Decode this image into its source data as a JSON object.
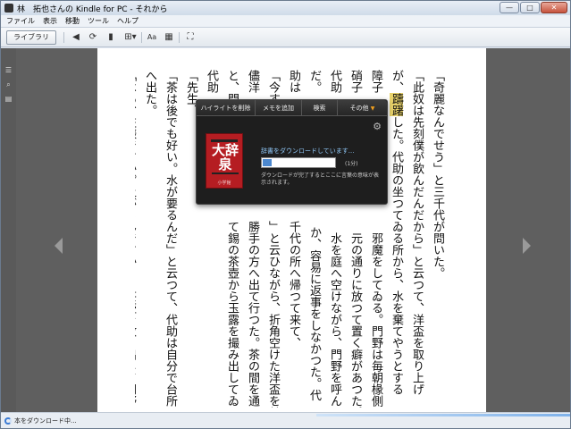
{
  "window": {
    "title": "林　拓也さんの Kindle for PC - それから",
    "minimize": "—",
    "maximize": "□",
    "close": "✕"
  },
  "menu": [
    "ファイル",
    "表示",
    "移動",
    "ツール",
    "ヘルプ"
  ],
  "toolbar": {
    "library_label": "ライブラリ",
    "icons": [
      "back-icon",
      "sync-icon",
      "bookmark-icon",
      "goto-icon",
      "font-size-icon",
      "view-mode-icon",
      "fullscreen-icon"
    ]
  },
  "sidebar_icons": [
    "list-icon",
    "search-icon",
    "notebook-icon"
  ],
  "page": {
    "columns": [
      "「奇麗なんでせう」と三千代が問いた。",
      "「此奴は先刻僕が飲んだんだから」と云つて、洋盃を取り上げ",
      "が、躊躇した。代助の坐つてゐる所から、水を棄てやうとする",
      "障子　　　　　　　　　　　　邪魔をしてゐる。門野は毎朝椽側の",
      "硝子　　　　　　　　　　　　元の通りに放つて置く癖があつた。",
      "代助　　　　　　　　　　　　水を庭へ空けながら、門野を呼ん",
      "だ。　　　　　　　　　　　　か、容易に返事をしなかつた。代",
      "助は　　　　　　　　　　　千代の所へ帰つて来て、",
      "「今す　　　　　　　　　　」と云ひながら、折角空けた洋盃を其",
      "儘洋　　　　　　　　　　　勝手の方へ出て行つた。茶の間を通る",
      "と、門　　　　　　　　　　て錫の茶壺から玉露を撮み出してゐる。",
      "代助　　　　　　　　",
      "「先生、　　　　　　　　",
      "「茶は後でも好い。水が要るんだ」と云つて、代助は自分で台所",
      "へ出た。",
      "「はあ、左様ですか。上がるんですか」と茶壺を放り出して門野"
    ],
    "highlighted_word": "躊躇"
  },
  "popup": {
    "tabs": [
      "ハイライトを削除",
      "メモを追加",
      "検索",
      "その他"
    ],
    "dictionary_title": "大辞泉",
    "dictionary_publisher": "小学館",
    "download_title": "辞書をダウンロードしています...",
    "time_remaining": "(1分)",
    "note": "ダウンロードが完了するとここに言葉の意味が表示されます。",
    "progress": 0.12
  },
  "status": {
    "text": "本をダウンロード中..."
  },
  "colors": {
    "accent": "#4c88cf",
    "popup_bg": "#1e1e1e",
    "highlight": "#e8d26a",
    "cover": "#b51d22"
  }
}
